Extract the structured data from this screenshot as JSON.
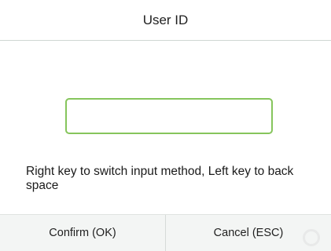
{
  "dialog": {
    "title": "User ID"
  },
  "input": {
    "value": "",
    "placeholder": ""
  },
  "hint": {
    "text": "Right key to switch input method, Left key to back space"
  },
  "footer": {
    "confirm_label": "Confirm (OK)",
    "cancel_label": "Cancel (ESC)"
  },
  "colors": {
    "input_border": "#86c55c",
    "footer_bg": "#f3f5f4"
  }
}
